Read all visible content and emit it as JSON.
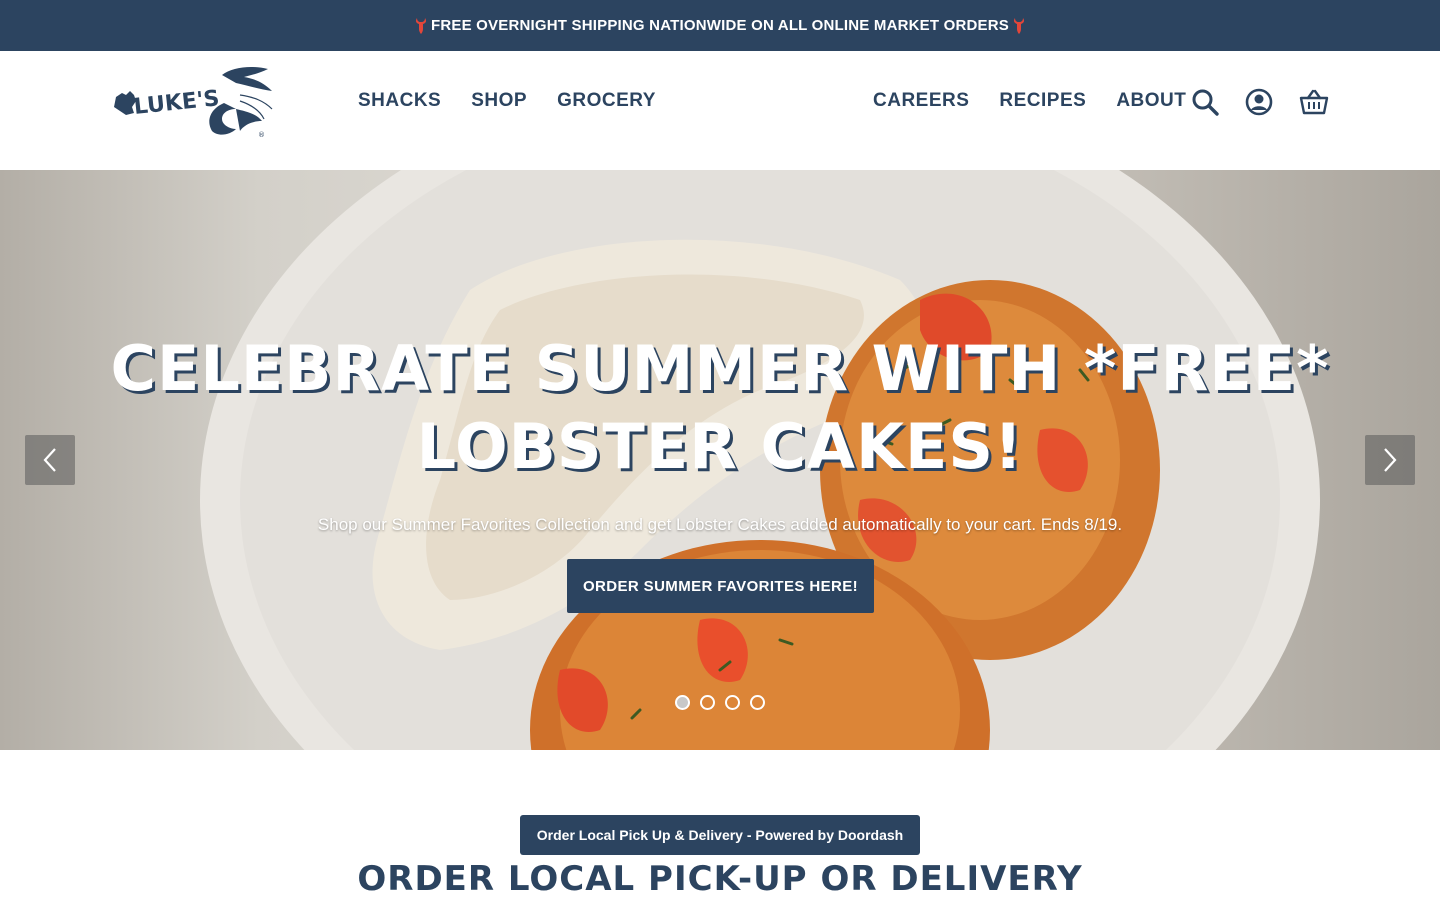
{
  "announcement": {
    "text": "FREE OVERNIGHT SHIPPING NATIONWIDE ON ALL ONLINE MARKET ORDERS",
    "icon": "lobster-icon",
    "accent_color": "#e2463a"
  },
  "brand": {
    "logo_text": "LUKE'S",
    "color": "#2c4460"
  },
  "nav": {
    "left": [
      "SHACKS",
      "SHOP",
      "GROCERY"
    ],
    "right": [
      "CAREERS",
      "RECIPES",
      "ABOUT"
    ],
    "icons": [
      "search-icon",
      "account-icon",
      "cart-icon"
    ]
  },
  "hero": {
    "title": "CELEBRATE SUMMER WITH *FREE* LOBSTER CAKES!",
    "subtitle": "Shop our Summer Favorites Collection and get Lobster Cakes added automatically to your cart. Ends 8/19.",
    "cta_label": "ORDER SUMMER FAVORITES HERE!",
    "slide_count": 4,
    "active_slide": 1
  },
  "local": {
    "button_label": "Order Local Pick Up & Delivery - Powered by Doordash",
    "heading": "ORDER LOCAL PICK-UP OR DELIVERY"
  }
}
